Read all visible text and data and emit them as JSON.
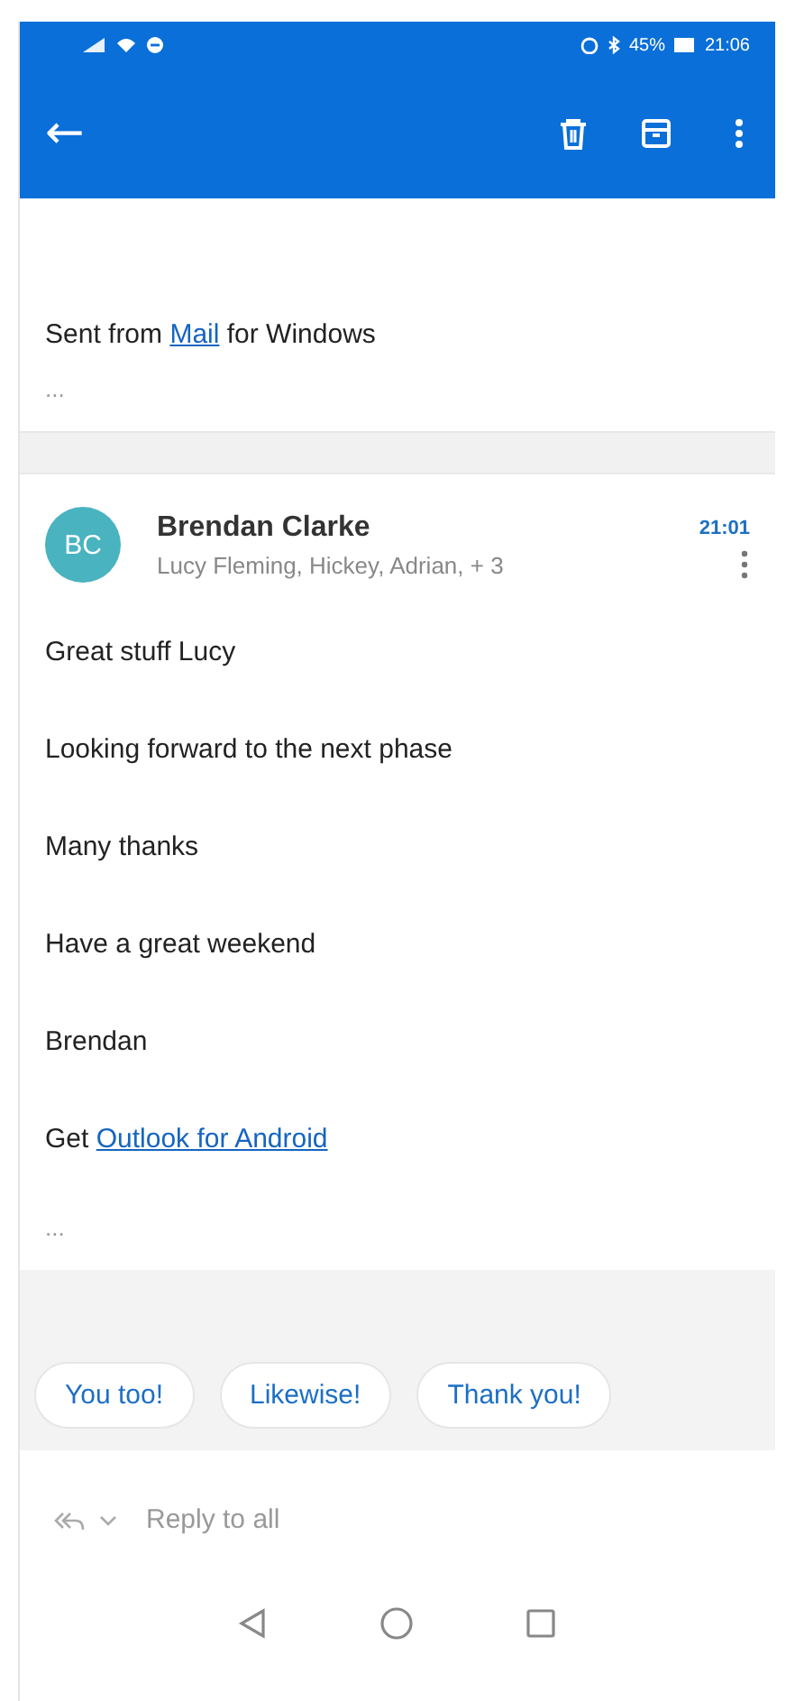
{
  "status_bar": {
    "battery": "45%",
    "time": "21:06"
  },
  "toolbar": {
    "back": "←",
    "actions": [
      {
        "kind": "delete"
      },
      {
        "kind": "archive"
      },
      {
        "kind": "more"
      }
    ]
  },
  "previous_message": {
    "signature": {
      "before": "Sent from ",
      "link": "Mail",
      "after": " for Windows"
    },
    "more": "..."
  },
  "message": {
    "initials": "BC",
    "color": "#4ab3c0",
    "sender": "Brendan Clarke",
    "recipients": "Lucy Fleming, Hickey, Adrian, + 3",
    "time": "21:01",
    "lines": [
      "Great stuff Lucy",
      "Looking forward to the next phase",
      "Many thanks",
      "Have a great weekend",
      "Brendan"
    ],
    "signature": {
      "before": "Get ",
      "link": "Outlook for Android"
    },
    "more": "..."
  },
  "quick_replies": [
    "You too!",
    "Likewise!",
    "Thank you!"
  ],
  "reply": {
    "label": "Reply to all"
  },
  "nav": [
    {
      "kind": "back"
    },
    {
      "kind": "home"
    },
    {
      "kind": "recents"
    }
  ]
}
